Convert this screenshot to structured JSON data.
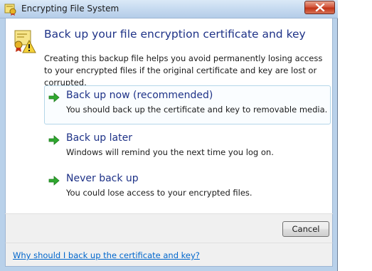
{
  "window": {
    "title": "Encrypting File System",
    "title_icon": "certificate-icon",
    "close_icon": "close-icon"
  },
  "header": {
    "icon": "certificate-warning-icon",
    "title": "Back up your file encryption certificate and key",
    "description": "Creating this backup file helps you avoid permanently losing access to your encrypted files if the original certificate and key are lost or corrupted."
  },
  "options": [
    {
      "title": "Back up now (recommended)",
      "subtitle": "You should back up the certificate and key to removable media.",
      "icon": "green-arrow-icon"
    },
    {
      "title": "Back up later",
      "subtitle": "Windows will remind you the next time you log on.",
      "icon": "green-arrow-icon"
    },
    {
      "title": "Never back up",
      "subtitle": "You could lose access to your encrypted files.",
      "icon": "green-arrow-icon"
    }
  ],
  "buttons": {
    "cancel": "Cancel"
  },
  "footer": {
    "help_link": "Why should I back up the certificate and key?"
  },
  "colors": {
    "heading": "#1e3287",
    "link": "#0066cc",
    "arrow": "#2fa82f",
    "close": "#c23417"
  }
}
